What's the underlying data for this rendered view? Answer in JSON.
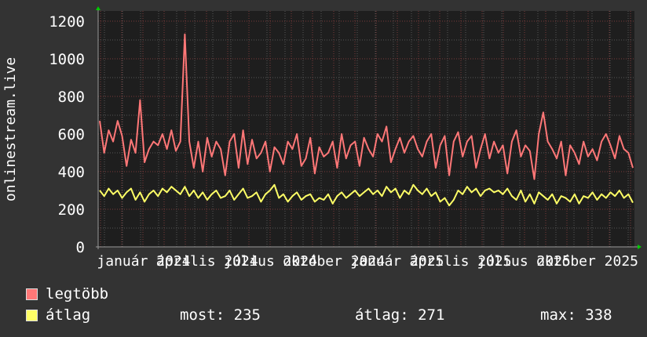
{
  "chart_data": {
    "type": "line",
    "ylabel": "onlinestream.live",
    "ylim": [
      0,
      1200
    ],
    "y_ticks": [
      "0",
      "200",
      "400",
      "600",
      "800",
      "1000",
      "1200"
    ],
    "y_tick_values": [
      0,
      200,
      400,
      600,
      800,
      1000,
      1200
    ],
    "x_tick_labels": [
      "január 2024",
      "április 2024",
      "július 2024",
      "október 2024",
      "január 2025",
      "április 2025",
      "július 2025",
      "október 2025"
    ],
    "grid": true,
    "legend_placement": "bottom-left",
    "colors": {
      "background": "#333333",
      "plot": "#1e1e1e",
      "grid": "#5a5a5a",
      "major_grid": "#7a3a3a",
      "axis_arrow": "#00cc00"
    },
    "series": [
      {
        "name": "legtöbb",
        "color": "#ff7777",
        "values": [
          670,
          500,
          620,
          560,
          670,
          590,
          430,
          570,
          500,
          780,
          450,
          520,
          560,
          540,
          600,
          520,
          620,
          510,
          560,
          1130,
          560,
          420,
          560,
          400,
          580,
          480,
          560,
          520,
          380,
          560,
          600,
          420,
          620,
          440,
          570,
          470,
          500,
          560,
          400,
          530,
          500,
          440,
          560,
          520,
          600,
          430,
          470,
          580,
          390,
          530,
          480,
          500,
          560,
          420,
          600,
          470,
          540,
          560,
          430,
          580,
          520,
          480,
          600,
          560,
          640,
          450,
          520,
          580,
          500,
          560,
          590,
          520,
          480,
          560,
          600,
          420,
          540,
          590,
          380,
          560,
          610,
          480,
          560,
          590,
          420,
          520,
          600,
          470,
          560,
          500,
          540,
          390,
          560,
          620,
          480,
          540,
          510,
          360,
          600,
          715,
          560,
          520,
          470,
          560,
          380,
          540,
          500,
          440,
          560,
          480,
          520,
          460,
          560,
          600,
          540,
          470,
          590,
          520,
          500,
          420
        ]
      },
      {
        "name": "átlag",
        "color": "#ffff66",
        "values": [
          300,
          270,
          310,
          280,
          300,
          260,
          290,
          310,
          250,
          290,
          240,
          280,
          300,
          270,
          310,
          290,
          320,
          300,
          280,
          320,
          270,
          300,
          260,
          290,
          250,
          280,
          300,
          260,
          270,
          300,
          250,
          280,
          310,
          260,
          270,
          290,
          240,
          280,
          300,
          330,
          260,
          280,
          240,
          270,
          290,
          250,
          270,
          280,
          240,
          260,
          250,
          280,
          230,
          270,
          290,
          260,
          280,
          300,
          270,
          290,
          310,
          280,
          300,
          270,
          320,
          290,
          310,
          260,
          300,
          280,
          330,
          300,
          280,
          310,
          270,
          290,
          240,
          260,
          220,
          250,
          300,
          280,
          320,
          290,
          310,
          270,
          300,
          310,
          290,
          300,
          280,
          310,
          270,
          250,
          300,
          240,
          280,
          230,
          290,
          270,
          250,
          280,
          230,
          270,
          260,
          240,
          280,
          230,
          270,
          260,
          290,
          250,
          280,
          260,
          290,
          270,
          300,
          260,
          280,
          235
        ]
      }
    ]
  },
  "legend": {
    "max_label": "legtöbb",
    "avg_label": "átlag",
    "now": "most: 235",
    "average": "átlag: 271",
    "maximum": "max: 338"
  }
}
